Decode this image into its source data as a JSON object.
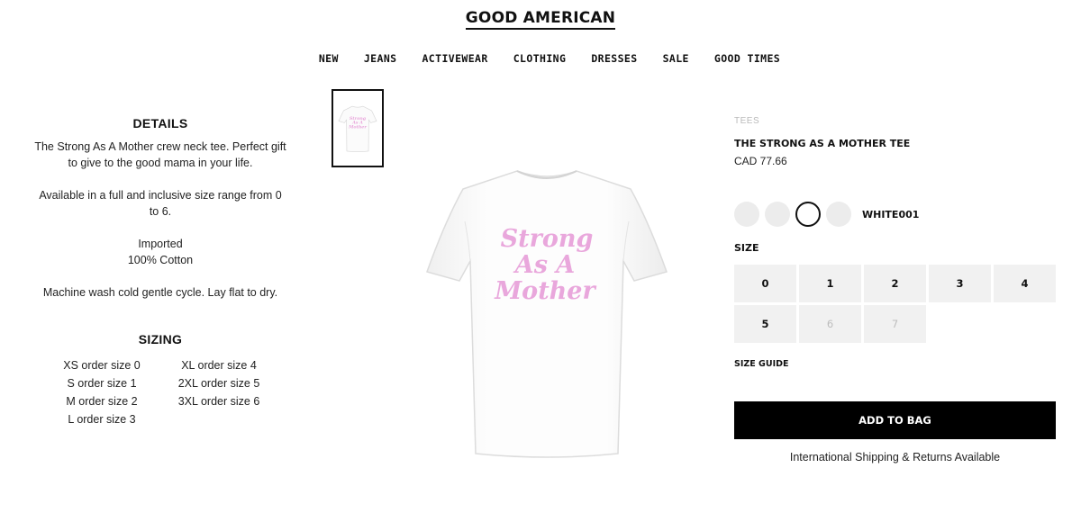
{
  "brand": {
    "logo": "GOOD AMERICAN"
  },
  "nav": {
    "items": [
      "NEW",
      "JEANS",
      "ACTIVEWEAR",
      "CLOTHING",
      "DRESSES",
      "SALE",
      "GOOD TIMES"
    ]
  },
  "details": {
    "title": "DETAILS",
    "paragraphs": [
      "The Strong As A Mother crew neck tee. Perfect gift to give to the good mama in your life.",
      "Available in a full and inclusive size range from 0 to 6.",
      "Imported",
      "100% Cotton",
      "Machine wash cold gentle cycle. Lay flat to dry."
    ],
    "sizing_title": "SIZING",
    "sizing_left": [
      "XS order size 0",
      "S order size 1",
      "M order size 2",
      "L order size 3"
    ],
    "sizing_right": [
      "XL order size 4",
      "2XL order size 5",
      "3XL order size 6"
    ]
  },
  "image": {
    "print_lines": [
      "Strong",
      "As A",
      "Mother"
    ],
    "print_color": "#e9a7dc"
  },
  "product": {
    "category": "TEES",
    "title": "THE STRONG AS A MOTHER TEE",
    "price": "CAD 77.66",
    "color_label": "WHITE001",
    "size_label": "SIZE",
    "sizes": [
      {
        "label": "0",
        "available": true
      },
      {
        "label": "1",
        "available": true
      },
      {
        "label": "2",
        "available": true
      },
      {
        "label": "3",
        "available": true
      },
      {
        "label": "4",
        "available": true
      },
      {
        "label": "5",
        "available": true
      },
      {
        "label": "6",
        "available": false
      },
      {
        "label": "7",
        "available": false
      }
    ],
    "size_guide": "SIZE GUIDE",
    "add_to_bag": "ADD TO BAG",
    "shipping_note": "International Shipping & Returns Available"
  }
}
